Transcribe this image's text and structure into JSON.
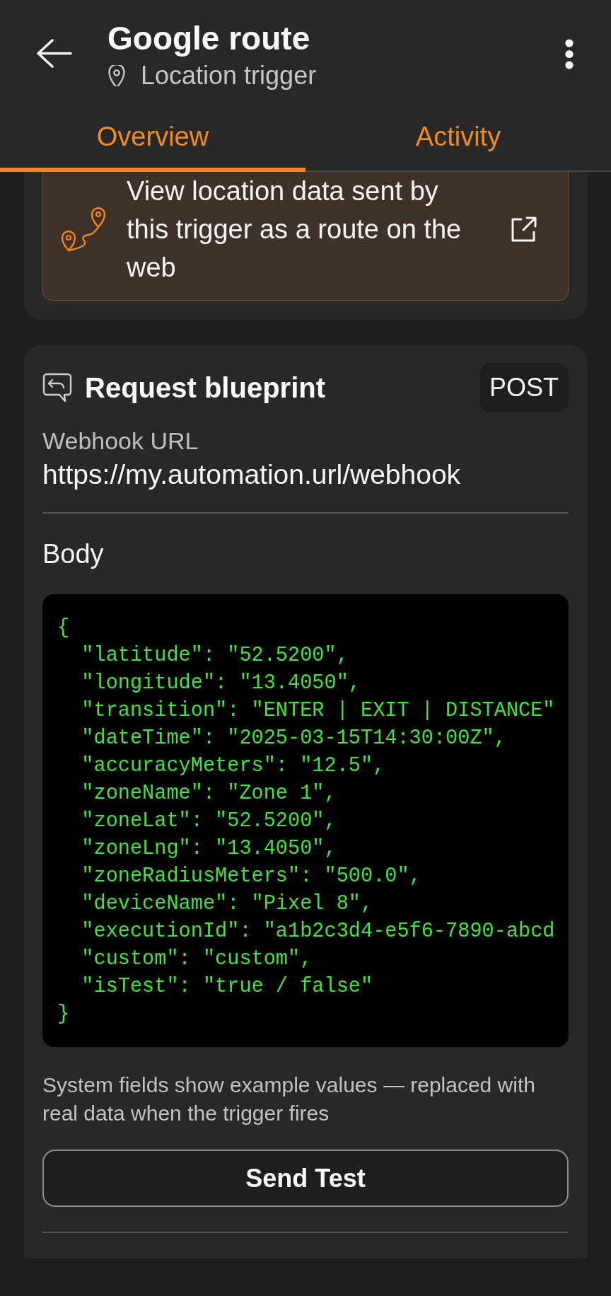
{
  "app_bar": {
    "title": "Google route",
    "subtitle": "Location trigger"
  },
  "tabs": [
    {
      "label": "Overview",
      "selected": true
    },
    {
      "label": "Activity",
      "selected": false
    }
  ],
  "route_link": {
    "text": "View location data sent by this trigger as a route on the web"
  },
  "request_blueprint": {
    "title": "Request blueprint",
    "method": "POST",
    "url_label": "Webhook URL",
    "url": "https://my.automation.url/webhook",
    "body_label": "Body",
    "body": {
      "open": "{",
      "fields": [
        "\"latitude\": \"52.5200\",",
        "\"longitude\": \"13.4050\",",
        "\"transition\": \"ENTER | EXIT | DISTANCE\"",
        "\"dateTime\": \"2025-03-15T14:30:00Z\",",
        "\"accuracyMeters\": \"12.5\",",
        "\"zoneName\": \"Zone 1\",",
        "\"zoneLat\": \"52.5200\",",
        "\"zoneLng\": \"13.4050\",",
        "\"zoneRadiusMeters\": \"500.0\",",
        "\"deviceName\": \"Pixel 8\",",
        "\"executionId\": \"a1b2c3d4-e5f6-7890-abcd",
        "\"custom\": \"custom\",",
        "\"isTest\": \"true / false\""
      ],
      "close": "}"
    },
    "note": "System fields show example values — replaced with real data when the trigger fires",
    "button": "Send Test"
  }
}
